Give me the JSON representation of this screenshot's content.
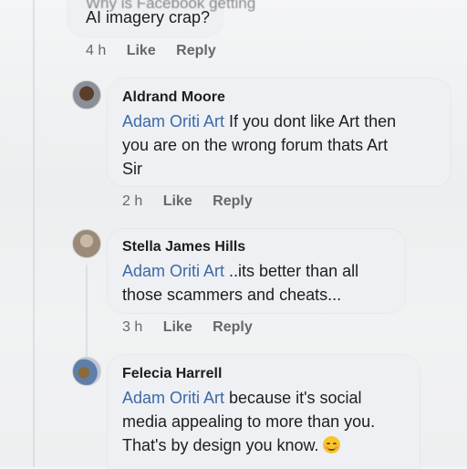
{
  "top_comment": {
    "partial_text": "Why is Facebook getting",
    "text_line": "AI imagery crap?",
    "time": "4 h",
    "like_label": "Like",
    "reply_label": "Reply"
  },
  "comments": [
    {
      "author": "Aldrand Moore",
      "mention": "Adam Oriti Art",
      "line1_rest": " If you dont like Art then",
      "line2": "you are on the wrong forum thats Art",
      "line3": "Sir",
      "time": "2 h",
      "like_label": "Like",
      "reply_label": "Reply"
    },
    {
      "author": "Stella James Hills",
      "mention": "Adam Oriti Art",
      "line1_rest": " ..its better than all",
      "line2": "those scammers and cheats...",
      "time": "3 h",
      "like_label": "Like",
      "reply_label": "Reply"
    },
    {
      "author": "Felecia Harrell",
      "mention": "Adam Oriti Art",
      "line1_rest": " because it's social",
      "line2": "media appealing to more than you.",
      "line3": "That's by design you know.",
      "emoji": "smiling-face-icon"
    }
  ],
  "colors": {
    "mention": "#3b6aa8",
    "bubble": "#eef0f3",
    "meta": "#65676b"
  }
}
